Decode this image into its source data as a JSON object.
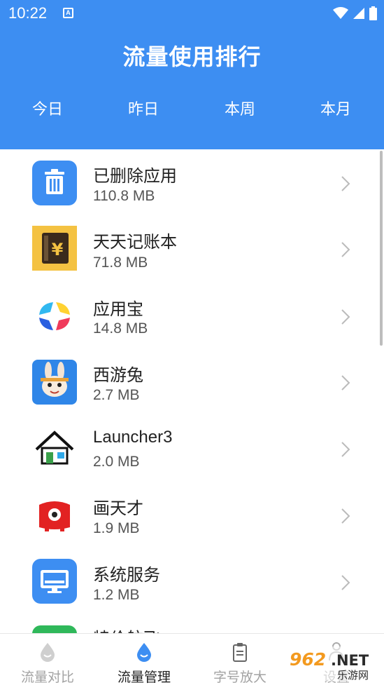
{
  "status_bar": {
    "time": "10:22",
    "a_badge": "A"
  },
  "header": {
    "title": "流量使用排行",
    "tabs": [
      "今日",
      "昨日",
      "本周",
      "本月"
    ]
  },
  "apps": [
    {
      "name": "已删除应用",
      "size": "110.8 MB",
      "icon": "trash-icon"
    },
    {
      "name": "天天记账本",
      "size": "71.8 MB",
      "icon": "yuan-book-icon"
    },
    {
      "name": "应用宝",
      "size": "14.8 MB",
      "icon": "yingyongbao-icon"
    },
    {
      "name": "西游兔",
      "size": "2.7 MB",
      "icon": "rabbit-icon"
    },
    {
      "name": "Launcher3",
      "size": "2.0 MB",
      "icon": "house-icon"
    },
    {
      "name": "画天才",
      "size": "1.9 MB",
      "icon": "red-monster-icon"
    },
    {
      "name": "系统服务",
      "size": "1.2 MB",
      "icon": "monitor-icon"
    },
    {
      "name": "特价航飞",
      "size": "",
      "icon": "green-app-icon"
    }
  ],
  "bottom_nav": [
    {
      "label": "流量对比",
      "icon": "drop-icon",
      "active": false
    },
    {
      "label": "流量管理",
      "icon": "drop-icon",
      "active": true
    },
    {
      "label": "字号放大",
      "icon": "clipboard-icon",
      "active": false
    },
    {
      "label": "设置",
      "icon": "person-icon",
      "active": false
    }
  ],
  "watermark": {
    "text": "962.NET",
    "subtext": "乐游网"
  },
  "colors": {
    "header_bg": "#3d8ef2",
    "primary": "#3d8ef2",
    "nav_inactive": "#a3a3a3"
  }
}
